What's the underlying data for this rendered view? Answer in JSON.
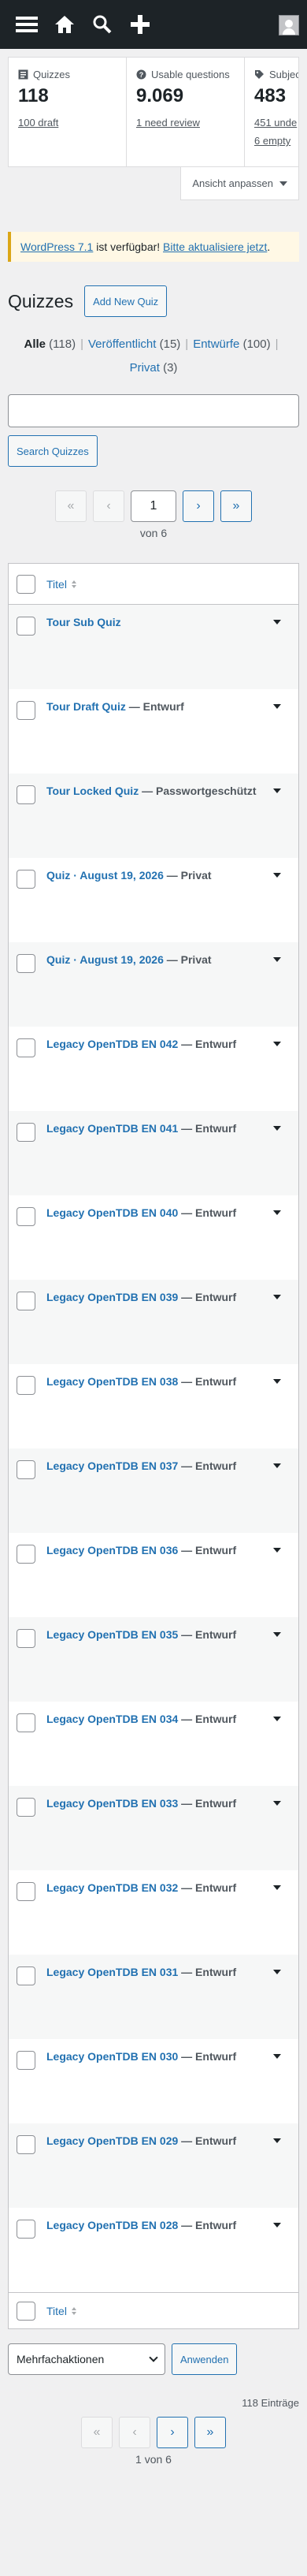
{
  "adminbar": {
    "icons": [
      "menu-icon",
      "home-icon",
      "search-icon",
      "plus-icon",
      "avatar"
    ]
  },
  "stats": [
    {
      "label": "Quizzes",
      "icon": "quiz-icon",
      "value": "118",
      "sub": "100 draft",
      "sub2": ""
    },
    {
      "label": "Usable questions",
      "icon": "question-icon",
      "value": "9.069",
      "sub": "1 need review",
      "sub2": ""
    },
    {
      "label": "Subjects",
      "icon": "tag-icon",
      "value": "483",
      "sub": "451 unde",
      "sub2": "6 empty"
    }
  ],
  "screen_options": {
    "label": "Ansicht anpassen"
  },
  "notice": {
    "link1": "WordPress 7.1",
    "text": " ist verfügbar! ",
    "link2": "Bitte aktualisiere jetzt",
    "end": "."
  },
  "page": {
    "title": "Quizzes",
    "add_new": "Add New Quiz"
  },
  "filters": [
    {
      "label": "Alle",
      "count": "(118)",
      "current": true
    },
    {
      "label": "Veröffentlicht",
      "count": "(15)",
      "current": false
    },
    {
      "label": "Entwürfe",
      "count": "(100)",
      "current": false
    },
    {
      "label": "Privat",
      "count": "(3)",
      "current": false
    }
  ],
  "search": {
    "button": "Search Quizzes",
    "value": ""
  },
  "pagination": {
    "first": "«",
    "prev": "‹",
    "next": "›",
    "last": "»",
    "current": "1",
    "of_label": "von 6",
    "bottom_label": "1 von 6"
  },
  "table": {
    "column_title": "Titel",
    "rows": [
      {
        "title": "Tour Sub Quiz",
        "state": ""
      },
      {
        "title": "Tour Draft Quiz",
        "state": " — Entwurf"
      },
      {
        "title": "Tour Locked Quiz",
        "state": " — Passwortgeschützt"
      },
      {
        "title": "Quiz · August 19, 2026",
        "state": " — Privat"
      },
      {
        "title": "Quiz · August 19, 2026",
        "state": " — Privat"
      },
      {
        "title": "Legacy OpenTDB EN 042",
        "state": " — Entwurf"
      },
      {
        "title": "Legacy OpenTDB EN 041",
        "state": " — Entwurf"
      },
      {
        "title": "Legacy OpenTDB EN 040",
        "state": " — Entwurf"
      },
      {
        "title": "Legacy OpenTDB EN 039",
        "state": " — Entwurf"
      },
      {
        "title": "Legacy OpenTDB EN 038",
        "state": " — Entwurf"
      },
      {
        "title": "Legacy OpenTDB EN 037",
        "state": " — Entwurf"
      },
      {
        "title": "Legacy OpenTDB EN 036",
        "state": " — Entwurf"
      },
      {
        "title": "Legacy OpenTDB EN 035",
        "state": " — Entwurf"
      },
      {
        "title": "Legacy OpenTDB EN 034",
        "state": " — Entwurf"
      },
      {
        "title": "Legacy OpenTDB EN 033",
        "state": " — Entwurf"
      },
      {
        "title": "Legacy OpenTDB EN 032",
        "state": " — Entwurf"
      },
      {
        "title": "Legacy OpenTDB EN 031",
        "state": " — Entwurf"
      },
      {
        "title": "Legacy OpenTDB EN 030",
        "state": " — Entwurf"
      },
      {
        "title": "Legacy OpenTDB EN 029",
        "state": " — Entwurf"
      },
      {
        "title": "Legacy OpenTDB EN 028",
        "state": " — Entwurf"
      }
    ]
  },
  "bulk": {
    "select_label": "Mehrfachaktionen",
    "apply": "Anwenden"
  },
  "entries": "118 Einträge"
}
